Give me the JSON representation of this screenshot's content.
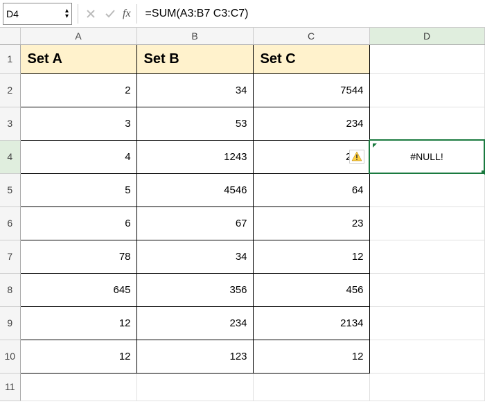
{
  "nameBox": "D4",
  "formula": "=SUM(A3:B7 C3:C7)",
  "columns": [
    "A",
    "B",
    "C",
    "D"
  ],
  "selectedColumn": "D",
  "selectedRow": 4,
  "rowCount": 11,
  "headers": {
    "A": "Set A",
    "B": "Set B",
    "C": "Set C"
  },
  "data": {
    "2": {
      "A": "2",
      "B": "34",
      "C": "7544"
    },
    "3": {
      "A": "3",
      "B": "53",
      "C": "234"
    },
    "4": {
      "A": "4",
      "B": "1243",
      "C": "235",
      "D": "#NULL!"
    },
    "5": {
      "A": "5",
      "B": "4546",
      "C": "64"
    },
    "6": {
      "A": "6",
      "B": "67",
      "C": "23"
    },
    "7": {
      "A": "78",
      "B": "34",
      "C": "12"
    },
    "8": {
      "A": "645",
      "B": "356",
      "C": "456"
    },
    "9": {
      "A": "12",
      "B": "234",
      "C": "2134"
    },
    "10": {
      "A": "12",
      "B": "123",
      "C": "12"
    }
  },
  "warningCell": {
    "row": 4,
    "col": "C"
  },
  "selectedCell": {
    "row": 4,
    "col": "D"
  },
  "chart_data": {
    "type": "table",
    "title": "",
    "columns": [
      "Set A",
      "Set B",
      "Set C"
    ],
    "rows": [
      [
        2,
        34,
        7544
      ],
      [
        3,
        53,
        234
      ],
      [
        4,
        1243,
        235
      ],
      [
        5,
        4546,
        64
      ],
      [
        6,
        67,
        23
      ],
      [
        78,
        34,
        12
      ],
      [
        645,
        356,
        456
      ],
      [
        12,
        234,
        2134
      ],
      [
        12,
        123,
        12
      ]
    ]
  }
}
